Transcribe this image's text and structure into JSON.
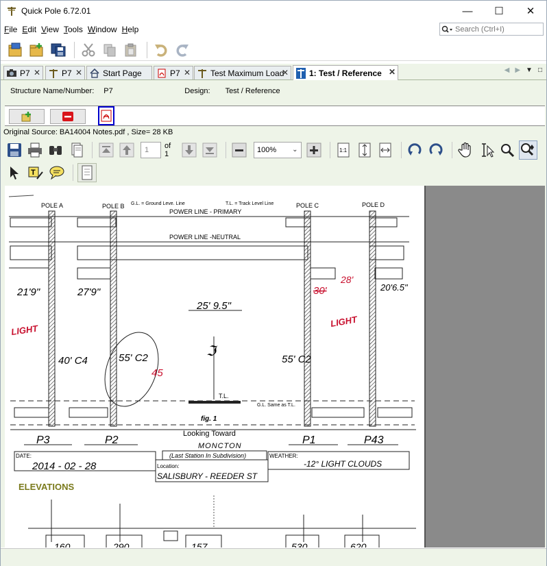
{
  "window": {
    "title": "Quick Pole 6.72.01"
  },
  "menu": [
    "File",
    "Edit",
    "View",
    "Tools",
    "Window",
    "Help"
  ],
  "menu_mnemonic": [
    "F",
    "E",
    "V",
    "T",
    "W",
    "H"
  ],
  "search": {
    "placeholder": "Search (Ctrl+I)"
  },
  "tabs": [
    {
      "label": "P7",
      "icon": "camera-icon",
      "active": false
    },
    {
      "label": "P7",
      "icon": "pole-icon",
      "active": false
    },
    {
      "label": "Start Page",
      "icon": "home-icon",
      "active": false
    },
    {
      "label": "P7",
      "icon": "pdf-icon",
      "active": false
    },
    {
      "label": "Test Maximum Load",
      "icon": "pole-icon",
      "active": false
    },
    {
      "label": "1: Test / Reference",
      "icon": "pole-blue-icon",
      "active": true
    }
  ],
  "structure": {
    "name_label": "Structure Name/Number:",
    "name_value": "P7",
    "design_label": "Design:",
    "design_value": "Test / Reference"
  },
  "source": "Original Source: BA14004 Notes.pdf , Size= 28 KB",
  "pdf_toolbar": {
    "page_value": "1",
    "page_of": "of 1",
    "zoom": "100%"
  },
  "document": {
    "poles": [
      "POLE A",
      "POLE B",
      "POLE C",
      "POLE D"
    ],
    "legend_gl": "G.L. = Ground Leve. Line",
    "legend_tl": "T.L. = Track Level Line",
    "power_primary": "POWER LINE - PRIMARY",
    "power_neutral": "POWER LINE -NEUTRAL",
    "height_a": "21'9\"",
    "height_b": "27'9\"",
    "height_c": "30'",
    "height_c2": "28'",
    "height_d": "20'6.5\"",
    "span": "25' 9.5\"",
    "light_left": "LIGHT",
    "light_right": "LIGHT",
    "a_note": "40' C4",
    "b_note": "55' C2",
    "b_note2": "45",
    "c_note": "55' C2",
    "tl_label": "T.L.",
    "gl_label": "G.L. Same as T.L.",
    "fig": "fig. 1",
    "looking_toward": "Looking Toward",
    "moncton": "MONCTON",
    "last_station": "(Last Station In Subdivision)",
    "date_label": "DATE:",
    "date_value": "2014 - 02 - 28",
    "weather_label": "WEATHER:",
    "weather_value": "-12° LIGHT CLOUDS",
    "location_label": "Location:",
    "location_value": "SALISBURY - REEDER ST",
    "p_labels": [
      "P3",
      "P2",
      "P1",
      "P43"
    ],
    "elevations": "ELEVATIONS",
    "elev_values": [
      "160",
      "290",
      "157",
      "530",
      "620"
    ]
  },
  "colors": {
    "panel_bg": "#eef4e8",
    "accent_blue": "#0000cc",
    "handwriting_red": "#c8102e",
    "elevations_olive": "#7a7a1c"
  }
}
